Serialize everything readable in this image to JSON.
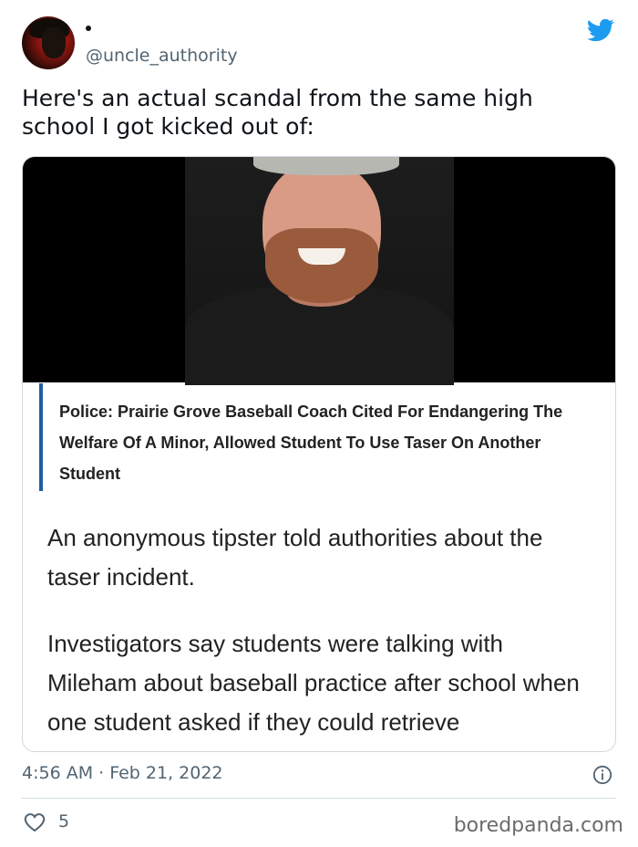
{
  "author": {
    "handle": "@uncle_authority"
  },
  "tweet": {
    "text": "Here's an actual scandal from the same high school I got kicked out of:",
    "timestamp": "4:56 AM · Feb 21, 2022",
    "likes": "5"
  },
  "card": {
    "headline": "Police: Prairie Grove Baseball Coach Cited For Endangering The Welfare Of A Minor, Allowed Student To Use Taser On Another Student",
    "paragraph1": "An anonymous tipster told authorities about the taser incident.",
    "paragraph2": "Investigators say students were talking with Mileham about baseball practice after school when one student asked if they could retrieve"
  },
  "watermark": "boredpanda.com",
  "colors": {
    "twitter_blue": "#1d9bf0",
    "muted_text": "#536471",
    "quote_bar": "#1f5fa0"
  },
  "icons": [
    "twitter-logo-icon",
    "info-icon",
    "heart-icon"
  ]
}
